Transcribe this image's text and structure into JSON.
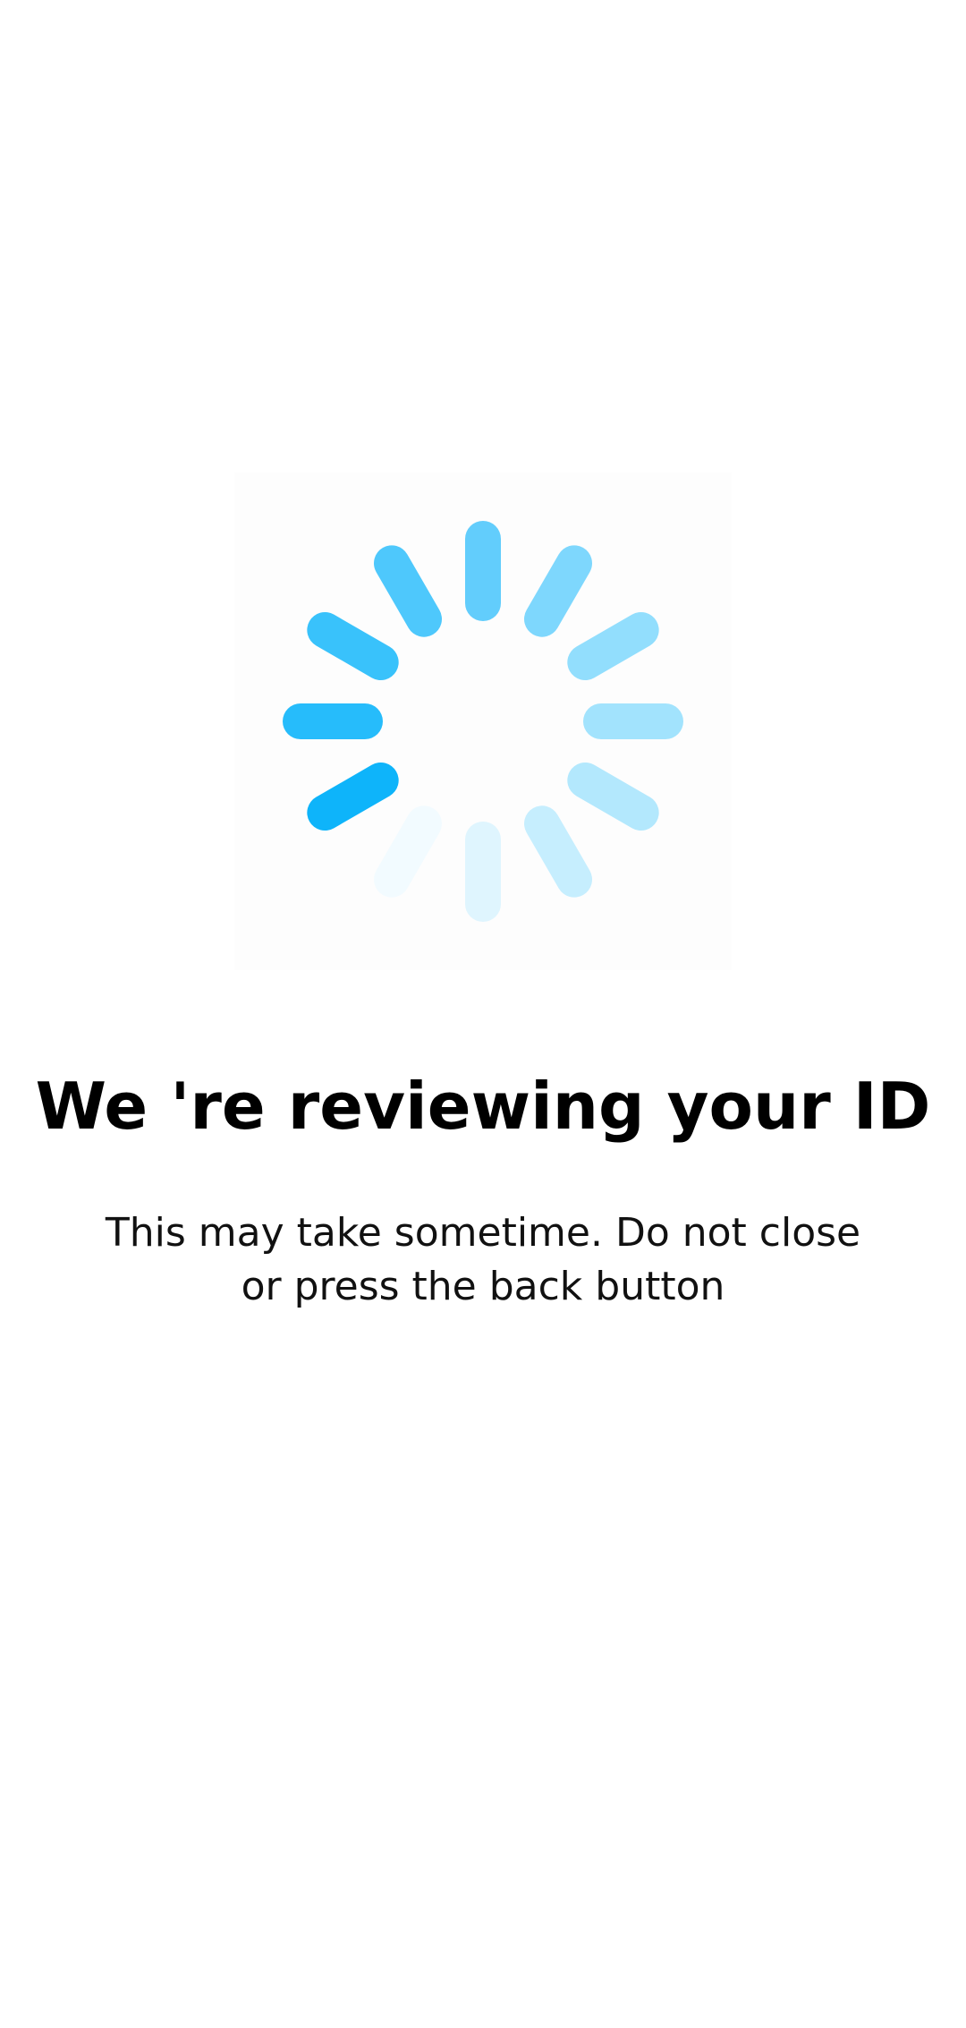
{
  "spinner": {
    "icon": "loading-spinner-icon",
    "segment_colors": [
      "#62cdfc",
      "#7ed7fd",
      "#92defd",
      "#a2e3fd",
      "#b3e8fd",
      "#c6eefe",
      "#dff5fe",
      "#f2fbff",
      "#0eb4fa",
      "#26bcfb",
      "#39c2fb",
      "#4ec8fc"
    ]
  },
  "review": {
    "title": "We 're reviewing your ID",
    "message": "This may take sometime. Do not close or press the back button"
  }
}
